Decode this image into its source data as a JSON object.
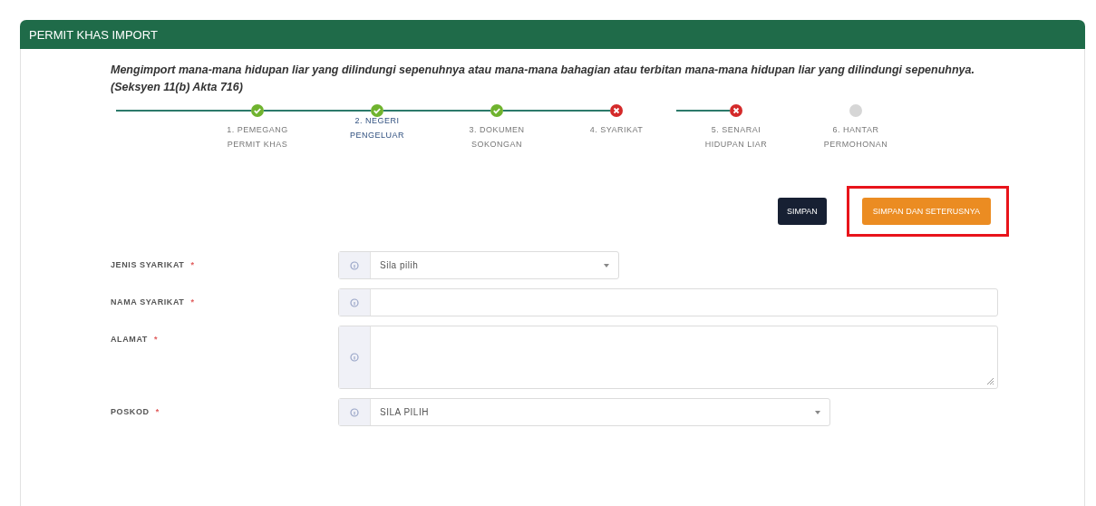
{
  "panel": {
    "title": "PERMIT KHAS IMPORT"
  },
  "description": "Mengimport mana-mana hidupan liar yang dilindungi sepenuhnya atau mana-mana bahagian atau terbitan mana-mana hidupan liar yang dilindungi sepenuhnya. (Seksyen 11(b) Akta 716)",
  "steps": [
    {
      "label": "1. PEMEGANG PERMIT KHAS",
      "kind": "done",
      "selected": false
    },
    {
      "label": "2. NEGERI PENGELUAR",
      "kind": "done",
      "selected": true
    },
    {
      "label": "3. DOKUMEN SOKONGAN",
      "kind": "done",
      "selected": false
    },
    {
      "label": "4. SYARIKAT",
      "kind": "error",
      "selected": false
    },
    {
      "label": "5. SENARAI HIDUPAN LIAR",
      "kind": "error",
      "selected": false
    },
    {
      "label": "6. HANTAR PERMOHONAN",
      "kind": "pending",
      "selected": false
    }
  ],
  "buttons": [
    {
      "label": "SIMPAN",
      "kind": "dark",
      "highlighted": false
    },
    {
      "label": "SIMPAN DAN SETERUSNYA",
      "kind": "orange",
      "highlighted": true
    }
  ],
  "fields": [
    {
      "label": "JENIS SYARIKAT",
      "required_mark": "*",
      "kind": "select",
      "value": "Sila pilih"
    },
    {
      "label": "NAMA SYARIKAT",
      "required_mark": "*",
      "kind": "text"
    },
    {
      "label": "ALAMAT",
      "required_mark": "*",
      "kind": "textarea"
    },
    {
      "label": "POSKOD",
      "required_mark": "*",
      "kind": "select",
      "value": "SILA PILIH"
    }
  ]
}
